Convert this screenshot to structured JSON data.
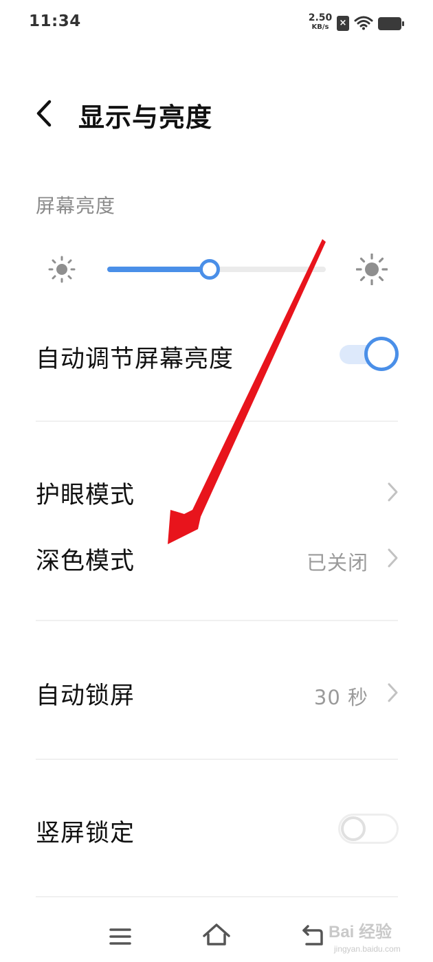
{
  "status_bar": {
    "time": "11:34",
    "net_speed_value": "2.50",
    "net_speed_unit": "KB/s",
    "sim_indicator": "×",
    "icons": [
      "no-sim-icon",
      "wifi-icon",
      "battery-icon"
    ]
  },
  "header": {
    "title": "显示与亮度",
    "back_icon": "chevron-left-icon"
  },
  "brightness": {
    "section_label": "屏幕亮度",
    "level_fraction": 0.47,
    "accent_color": "#4a8fe8"
  },
  "settings": {
    "auto_brightness": {
      "label": "自动调节屏幕亮度",
      "enabled": true
    },
    "eye_protection": {
      "label": "护眼模式"
    },
    "dark_mode": {
      "label": "深色模式",
      "value": "已关闭"
    },
    "auto_lock": {
      "label": "自动锁屏",
      "value": "30 秒"
    },
    "portrait_lock": {
      "label": "竖屏锁定",
      "enabled": false
    }
  },
  "nav_bar": {
    "icons": [
      "menu-icon",
      "home-icon",
      "back-icon"
    ]
  },
  "watermark": {
    "main": "Bai  经验",
    "sub": "jingyan.baidu.com"
  },
  "annotation": {
    "arrow_color": "#e8141c"
  }
}
